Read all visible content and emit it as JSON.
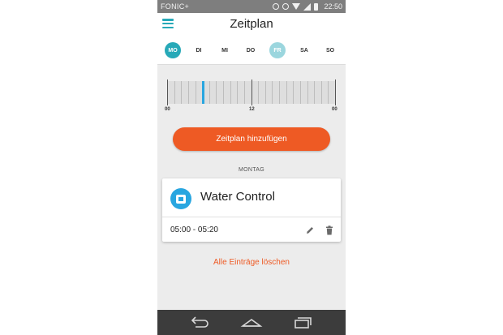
{
  "status_bar": {
    "carrier": "FONIC+",
    "time": "22:50"
  },
  "header": {
    "title": "Zeitplan"
  },
  "days": [
    {
      "label": "MO",
      "state": "selected"
    },
    {
      "label": "DI",
      "state": "normal"
    },
    {
      "label": "MI",
      "state": "normal"
    },
    {
      "label": "DO",
      "state": "normal"
    },
    {
      "label": "FR",
      "state": "today"
    },
    {
      "label": "SA",
      "state": "normal"
    },
    {
      "label": "SO",
      "state": "normal"
    }
  ],
  "timeline": {
    "labels": [
      "00",
      "12",
      "00"
    ],
    "scheduled_start": "05:00",
    "scheduled_end": "05:20"
  },
  "add_button": {
    "label": "Zeitplan hinzufügen"
  },
  "section": {
    "label": "MONTAG"
  },
  "entry": {
    "device_name": "Water Control",
    "time_range": "05:00 - 05:20",
    "icon": "water-control-icon"
  },
  "clear_link": {
    "label": "Alle Einträge löschen"
  },
  "colors": {
    "accent": "#27a9b8",
    "action": "#ee5a24",
    "device_icon": "#29a6e0"
  }
}
